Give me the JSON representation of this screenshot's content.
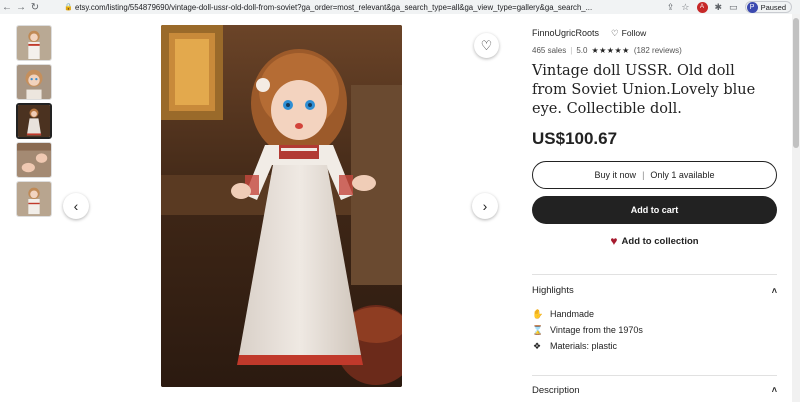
{
  "browser": {
    "url": "etsy.com/listing/554879690/vintage-doll-ussr-old-doll-from-soviet?ga_order=most_relevant&ga_search_type=all&ga_view_type=gallery&ga_search_...",
    "profile_initial": "P",
    "paused_label": "Paused",
    "nav_back_icon": "back-arrow-icon",
    "nav_forward_icon": "forward-arrow-icon",
    "nav_reload_icon": "reload-icon"
  },
  "listing": {
    "shop_name": "FinnoUgricRoots",
    "follow_label": "Follow",
    "sales": "465 sales",
    "rating_value": "5.0",
    "stars": "★★★★★",
    "reviews": "(182 reviews)",
    "title": "Vintage doll USSR. Old doll from Soviet Union.Lovely blue eye. Collectible doll.",
    "price": "US$100.67",
    "buy_now_label": "Buy it now",
    "availability": "Only 1 available",
    "add_to_cart_label": "Add to cart",
    "add_to_collection_label": "Add to collection"
  },
  "highlights": {
    "heading": "Highlights",
    "items": [
      {
        "icon": "hand-icon",
        "label": "Handmade"
      },
      {
        "icon": "vintage-icon",
        "label": "Vintage from the 1970s"
      },
      {
        "icon": "materials-icon",
        "label": "Materials: plastic"
      }
    ]
  },
  "description": {
    "heading": "Description"
  },
  "colors": {
    "primary_button": "#222222",
    "heart_red": "#a61a2e",
    "text": "#222222"
  }
}
